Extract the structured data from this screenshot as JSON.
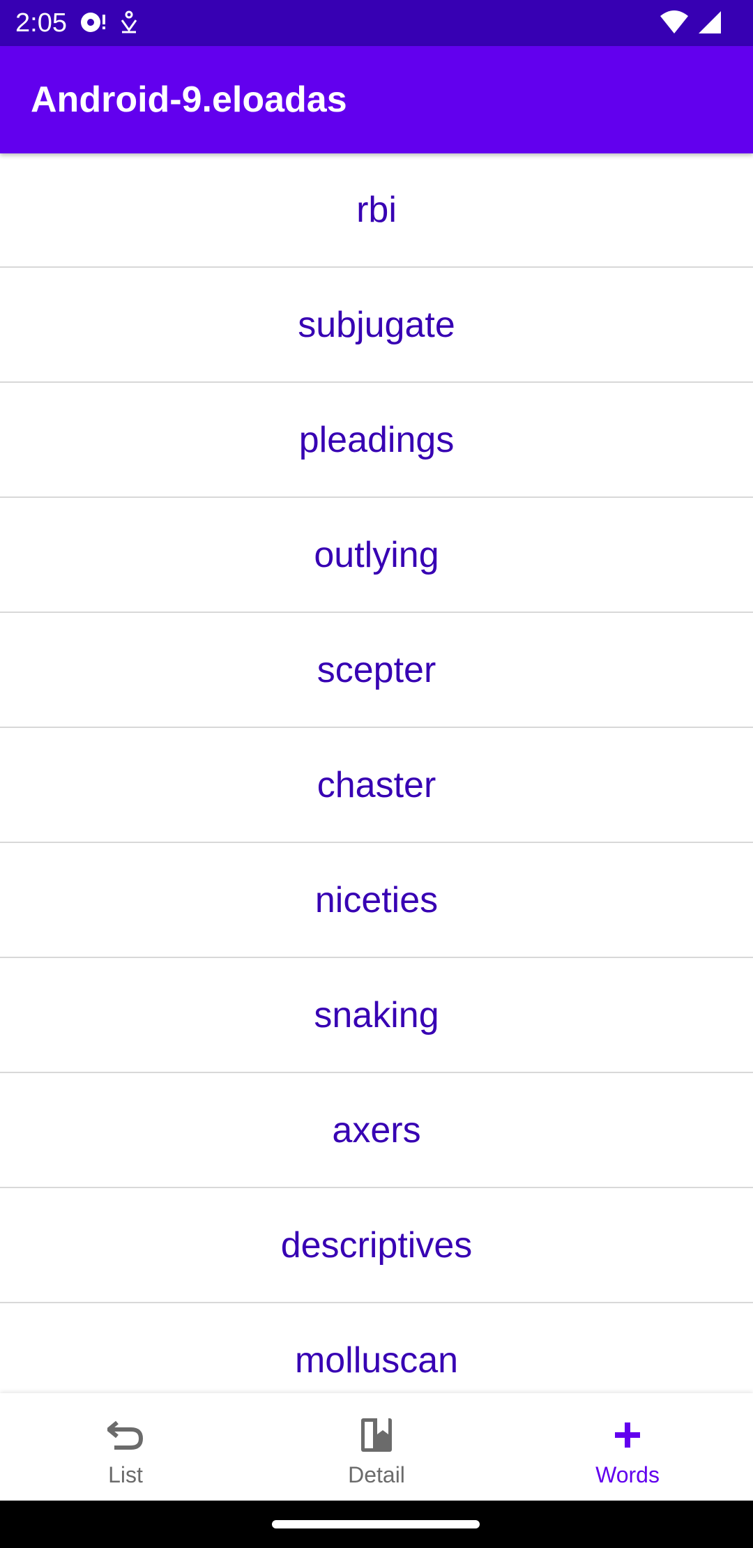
{
  "status_bar": {
    "time": "2:05",
    "left_icons": [
      "media-notification-icon",
      "download-notification-icon"
    ],
    "right_icons": [
      "wifi-icon",
      "cellular-signal-icon"
    ]
  },
  "app_bar": {
    "title": "Android-9.eloadas"
  },
  "words": [
    "rbi",
    "subjugate",
    "pleadings",
    "outlying",
    "scepter",
    "chaster",
    "niceties",
    "snaking",
    "axers",
    "descriptives",
    "molluscan"
  ],
  "bottom_nav": {
    "items": [
      {
        "label": "List",
        "icon": "undo-arrow-icon",
        "active": false
      },
      {
        "label": "Detail",
        "icon": "bookmark-book-icon",
        "active": false
      },
      {
        "label": "Words",
        "icon": "plus-icon",
        "active": true
      }
    ]
  },
  "colors": {
    "status_bar": "#3700b3",
    "app_bar": "#6200ee",
    "word_text": "#3700b3",
    "nav_active": "#6200ee",
    "nav_inactive": "#6b6b6b"
  }
}
